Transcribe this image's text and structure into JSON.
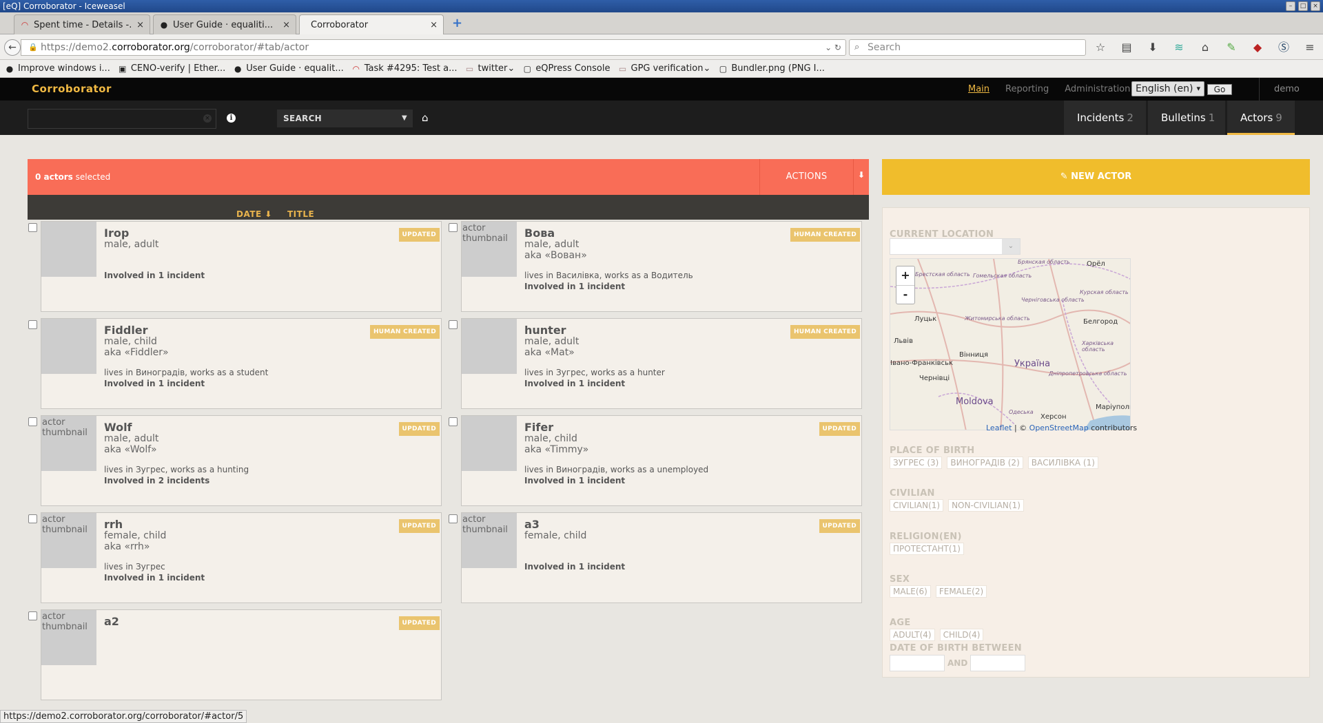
{
  "window": {
    "title": "[eQ] Corroborator - Iceweasel"
  },
  "tabs": [
    {
      "label": "Spent time - Details -...",
      "icon": "redmine-icon"
    },
    {
      "label": "User Guide · equaliti...",
      "icon": "github-icon"
    },
    {
      "label": "Corroborator",
      "icon": ""
    }
  ],
  "nav": {
    "url_prefix": "https://demo2.",
    "url_host": "corroborator.org",
    "url_path": "/corroborator/#tab/actor",
    "search_placeholder": "Search"
  },
  "bookmarks": [
    {
      "label": "Improve windows i...",
      "icon": "github-icon"
    },
    {
      "label": "CENO-verify | Ether...",
      "icon": "page-icon"
    },
    {
      "label": "User Guide · equalit...",
      "icon": "github-icon"
    },
    {
      "label": "Task #4295: Test a...",
      "icon": "redmine-icon"
    },
    {
      "label": "twitter",
      "icon": "folder-icon"
    },
    {
      "label": "eQPress Console",
      "icon": "page-icon"
    },
    {
      "label": "GPG verification",
      "icon": "folder-icon"
    },
    {
      "label": "Bundler.png (PNG I...",
      "icon": "page-icon"
    }
  ],
  "app": {
    "brand": "Corroborator",
    "topnav": [
      "Main",
      "Reporting",
      "Administration"
    ],
    "language": "English (en)",
    "go_label": "Go",
    "user": "demo",
    "search_type": "SEARCH",
    "main_tabs": [
      {
        "label": "Incidents",
        "count": "2"
      },
      {
        "label": "Bulletins",
        "count": "1"
      },
      {
        "label": "Actors",
        "count": "9"
      }
    ]
  },
  "selection": {
    "count": "0 actors",
    "suffix": " selected",
    "actions_label": "ACTIONS"
  },
  "sort": {
    "date": "DATE ⬇",
    "title": "TITLE"
  },
  "actors": [
    {
      "name": "Irop",
      "sex_age": "male, adult",
      "aka": "",
      "lives": "",
      "involved": "Involved in 1 incident",
      "badge": "UPDATED",
      "thumb_text": ""
    },
    {
      "name": "Вова",
      "sex_age": "male, adult",
      "aka": "aka «Вован»",
      "lives": "lives in Василівка, works as a Водитель",
      "involved": "Involved in 1 incident",
      "badge": "HUMAN CREATED",
      "thumb_text": "actor thumbnail"
    },
    {
      "name": "Fiddler",
      "sex_age": "male, child",
      "aka": "aka «Fiddler»",
      "lives": "lives in Виноградів, works as a student",
      "involved": "Involved in 1 incident",
      "badge": "HUMAN CREATED",
      "thumb_text": ""
    },
    {
      "name": "hunter",
      "sex_age": "male, adult",
      "aka": "aka «Mat»",
      "lives": "lives in Зугрес, works as a hunter",
      "involved": "Involved in 1 incident",
      "badge": "HUMAN CREATED",
      "thumb_text": ""
    },
    {
      "name": "Wolf",
      "sex_age": "male, adult",
      "aka": "aka «Wolf»",
      "lives": "lives in Зугрес, works as a hunting",
      "involved": "Involved in 2 incidents",
      "badge": "UPDATED",
      "thumb_text": "actor thumbnail"
    },
    {
      "name": "Fifer",
      "sex_age": "male, child",
      "aka": "aka «Timmy»",
      "lives": "lives in Виноградів, works as a unemployed",
      "involved": "Involved in 1 incident",
      "badge": "UPDATED",
      "thumb_text": ""
    },
    {
      "name": "rrh",
      "sex_age": "female, child",
      "aka": "aka «rrh»",
      "lives": "lives in Зугрес",
      "involved": "Involved in 1 incident",
      "badge": "UPDATED",
      "thumb_text": "actor thumbnail"
    },
    {
      "name": "a3",
      "sex_age": "female, child",
      "aka": "",
      "lives": "",
      "involved": "Involved in 1 incident",
      "badge": "UPDATED",
      "thumb_text": "actor thumbnail"
    },
    {
      "name": "a2",
      "sex_age": "",
      "aka": "",
      "lives": "",
      "involved": "",
      "badge": "UPDATED",
      "thumb_text": "actor thumbnail"
    }
  ],
  "sidebar": {
    "new_actor_label": "NEW ACTOR",
    "current_location_label": "CURRENT LOCATION",
    "map_labels": [
      "Брянская область",
      "Орёл",
      "Гомельская область",
      "Брестская область",
      "Курская область",
      "Черніговська область",
      "Луцьк",
      "Житомирська область",
      "Белгород",
      "Львів",
      "Вінниця",
      "Україна",
      "Харківська область",
      "Івано-Франківськ",
      "Дніпропетровська область",
      "Чернівці",
      "Moldova",
      "Одеська",
      "Херсон",
      "Маріуполь"
    ],
    "attribution": {
      "leaflet": "Leaflet",
      "sep": " | © ",
      "osm": "OpenStreetMap",
      "tail": " contributors"
    },
    "place_of_birth_label": "PLACE OF BIRTH",
    "place_of_birth": [
      "ЗУГРЕС (3)",
      "ВИНОГРАДІВ (2)",
      "ВАСИЛІВКА (1)"
    ],
    "civilian_label": "CIVILIAN",
    "civilian": [
      "CIVILIAN(1)",
      "NON-CIVILIAN(1)"
    ],
    "religion_label": "RELIGION(EN)",
    "religion": [
      "ПРОТЕСТАНТ(1)"
    ],
    "sex_label": "SEX",
    "sex": [
      "MALE(6)",
      "FEMALE(2)"
    ],
    "age_label": "AGE",
    "age": [
      "ADULT(4)",
      "CHILD(4)"
    ],
    "dob_label": "DATE OF BIRTH BETWEEN",
    "dob_and": "AND"
  },
  "status_url": "https://demo2.corroborator.org/corroborator/#actor/5"
}
